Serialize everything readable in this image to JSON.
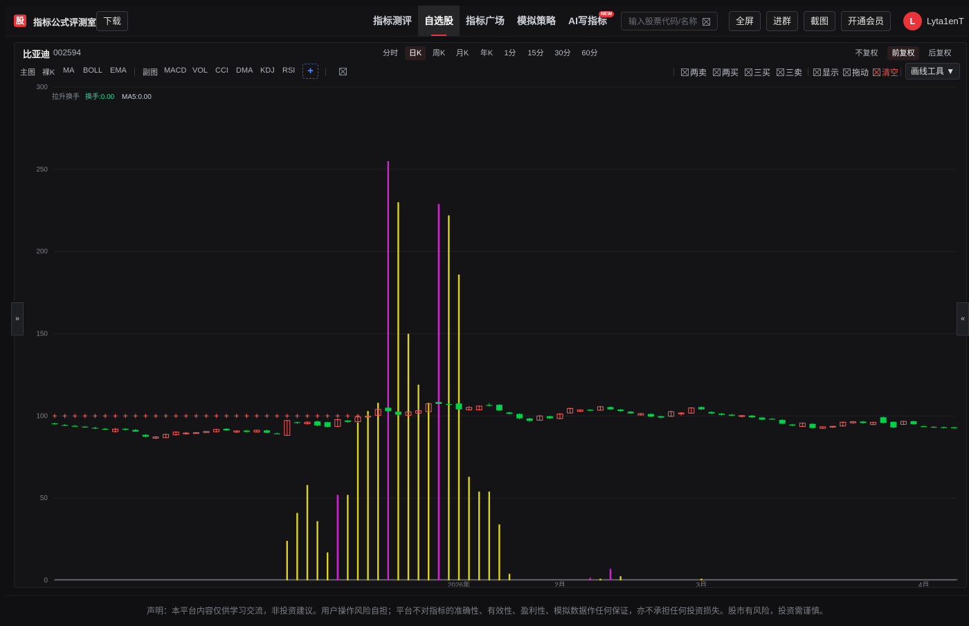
{
  "app": {
    "logo_char": "股",
    "title": "指标公式评测室",
    "download_label": "下载"
  },
  "nav": {
    "items": [
      {
        "label": "指标测评"
      },
      {
        "label": "自选股"
      },
      {
        "label": "指标广场"
      },
      {
        "label": "模拟策略"
      },
      {
        "label": "AI写指标"
      }
    ],
    "active_index": 1,
    "new_badge": "NEW"
  },
  "search": {
    "placeholder": "输入股票代码/名称",
    "value": ""
  },
  "toolbar": {
    "fullscreen": "全屏",
    "join_group": "进群",
    "screenshot": "截图",
    "membership": "开通会员"
  },
  "user": {
    "avatar_letter": "L",
    "name": "Lyta1enT"
  },
  "stock": {
    "name": "比亚迪",
    "code": "002594"
  },
  "periods": {
    "items": [
      "分时",
      "日K",
      "周K",
      "月K",
      "年K",
      "1分",
      "15分",
      "30分",
      "60分"
    ],
    "active": "日K"
  },
  "adjust": {
    "items": [
      "不复权",
      "前复权",
      "后复权"
    ],
    "active": "前复权"
  },
  "indicators": {
    "main_label": "主图",
    "main": [
      "裸K",
      "MA",
      "BOLL",
      "EMA"
    ],
    "sub_label": "副图",
    "sub": [
      "MACD",
      "VOL",
      "CCI",
      "DMA",
      "KDJ",
      "RSI"
    ],
    "plus": "+"
  },
  "options": {
    "items": [
      "两卖",
      "两买",
      "三买",
      "三卖",
      "显示",
      "拖动"
    ],
    "clear": "清空",
    "draw_tools": "画线工具 ▼"
  },
  "side": {
    "left": "»",
    "right": "«"
  },
  "legend": {
    "name": "拉升换手",
    "turnover": "换手:0.00",
    "ma5": "MA5:0.00"
  },
  "colors": {
    "up": "#ff5a5a",
    "down": "#00d04a",
    "volume_yellow": "#dcd41e",
    "volume_magenta": "#d81ed8",
    "cross": "#ff4d4d"
  },
  "footer": "声明：本平台内容仅供学习交流，非投资建议。用户操作风险自担；平台不对指标的准确性、有效性、盈利性、模拟数据作任何保证，亦不承担任何投资损失。股市有风险，投资需谨慎。",
  "chart_data": {
    "type": "bar",
    "ylim": [
      0,
      300
    ],
    "yticks": [
      0,
      50,
      100,
      150,
      200,
      250,
      300
    ],
    "xticks": [
      {
        "label": "2026年",
        "index": 40
      },
      {
        "label": "2月",
        "index": 50
      },
      {
        "label": "3月",
        "index": 64
      },
      {
        "label": "4月",
        "index": 86
      }
    ],
    "candles": [
      [
        95.5,
        96.0,
        94.5,
        95.0
      ],
      [
        94.5,
        95.0,
        93.8,
        94.2
      ],
      [
        94.0,
        94.5,
        93.4,
        93.8
      ],
      [
        93.5,
        94.0,
        92.8,
        93.2
      ],
      [
        92.8,
        93.4,
        92.0,
        92.4
      ],
      [
        92.2,
        92.8,
        91.4,
        91.8
      ],
      [
        90.5,
        92.6,
        89.8,
        92.0
      ],
      [
        92.2,
        92.6,
        91.2,
        91.6
      ],
      [
        91.5,
        92.0,
        90.2,
        90.5
      ],
      [
        88.5,
        89.0,
        87.0,
        87.4
      ],
      [
        86.5,
        87.8,
        86.0,
        87.2
      ],
      [
        86.8,
        89.2,
        86.5,
        88.8
      ],
      [
        88.5,
        90.6,
        88.2,
        90.2
      ],
      [
        89.2,
        90.3,
        88.7,
        89.6
      ],
      [
        89.6,
        90.3,
        89.2,
        89.8
      ],
      [
        89.9,
        90.9,
        89.6,
        90.6
      ],
      [
        90.4,
        92.1,
        90.1,
        91.8
      ],
      [
        92.2,
        92.6,
        90.9,
        91.2
      ],
      [
        90.2,
        91.2,
        89.6,
        90.9
      ],
      [
        91.1,
        91.5,
        89.9,
        90.3
      ],
      [
        90.3,
        91.6,
        90.0,
        91.3
      ],
      [
        91.2,
        91.6,
        89.4,
        89.8
      ],
      [
        89.4,
        89.9,
        89.0,
        89.2
      ],
      [
        88.2,
        97.6,
        87.9,
        97.2
      ],
      [
        96.2,
        96.6,
        95.2,
        95.7
      ],
      [
        95.3,
        96.7,
        94.7,
        96.2
      ],
      [
        96.7,
        97.1,
        93.7,
        94.2
      ],
      [
        96.2,
        96.5,
        93.0,
        93.4
      ],
      [
        93.6,
        98.3,
        93.4,
        97.8
      ],
      [
        97.2,
        97.6,
        96.0,
        96.4
      ],
      [
        96.5,
        100.3,
        96.1,
        99.4
      ],
      [
        99.5,
        101.1,
        99.0,
        99.8
      ],
      [
        100.4,
        104.6,
        100.1,
        104.0
      ],
      [
        105.0,
        105.4,
        102.5,
        102.9
      ],
      [
        102.6,
        103.2,
        100.1,
        100.8
      ],
      [
        100.4,
        102.9,
        100.0,
        102.5
      ],
      [
        101.7,
        104.0,
        101.2,
        103.2
      ],
      [
        102.6,
        108.0,
        102.3,
        107.4
      ],
      [
        108.5,
        108.9,
        106.9,
        107.3
      ],
      [
        107.3,
        107.7,
        106.7,
        107.1
      ],
      [
        107.6,
        108.0,
        103.6,
        104.0
      ],
      [
        103.7,
        105.9,
        103.3,
        105.2
      ],
      [
        103.7,
        106.4,
        103.3,
        106.0
      ],
      [
        106.7,
        107.9,
        105.7,
        106.2
      ],
      [
        106.8,
        107.2,
        102.9,
        103.4
      ],
      [
        102.1,
        102.6,
        100.9,
        101.3
      ],
      [
        101.2,
        101.6,
        98.0,
        98.6
      ],
      [
        98.5,
        98.9,
        96.4,
        97.0
      ],
      [
        97.4,
        100.6,
        97.1,
        100.0
      ],
      [
        99.8,
        100.2,
        98.2,
        98.6
      ],
      [
        98.4,
        101.6,
        98.1,
        101.2
      ],
      [
        101.8,
        105.0,
        101.5,
        104.6
      ],
      [
        102.8,
        104.0,
        102.4,
        103.6
      ],
      [
        103.8,
        104.2,
        102.8,
        103.2
      ],
      [
        103.5,
        106.1,
        103.2,
        105.6
      ],
      [
        105.4,
        105.8,
        103.6,
        104.0
      ],
      [
        103.9,
        104.3,
        102.6,
        103.0
      ],
      [
        102.6,
        103.0,
        101.2,
        101.6
      ],
      [
        100.6,
        101.8,
        100.2,
        101.4
      ],
      [
        101.2,
        101.6,
        99.2,
        99.6
      ],
      [
        99.8,
        100.2,
        98.6,
        99.0
      ],
      [
        99.8,
        103.2,
        99.4,
        102.6
      ],
      [
        101.4,
        102.2,
        100.3,
        101.8
      ],
      [
        101.7,
        105.3,
        101.4,
        104.9
      ],
      [
        105.4,
        105.8,
        103.6,
        104.0
      ],
      [
        102.4,
        102.8,
        101.1,
        101.5
      ],
      [
        101.4,
        101.8,
        100.3,
        100.7
      ],
      [
        100.8,
        101.2,
        99.9,
        100.2
      ],
      [
        99.8,
        100.5,
        99.0,
        100.2
      ],
      [
        100.2,
        100.6,
        98.9,
        99.2
      ],
      [
        99.0,
        99.4,
        97.4,
        97.8
      ],
      [
        98.3,
        98.7,
        97.7,
        98.1
      ],
      [
        97.6,
        98.0,
        94.9,
        95.3
      ],
      [
        94.8,
        95.2,
        93.8,
        94.2
      ],
      [
        93.6,
        96.0,
        93.2,
        95.6
      ],
      [
        95.2,
        95.6,
        92.3,
        92.7
      ],
      [
        92.5,
        93.7,
        92.2,
        93.4
      ],
      [
        93.2,
        94.0,
        92.8,
        93.7
      ],
      [
        93.9,
        96.6,
        93.5,
        96.2
      ],
      [
        95.8,
        96.9,
        95.4,
        96.5
      ],
      [
        96.6,
        97.0,
        95.3,
        95.7
      ],
      [
        94.8,
        96.5,
        94.4,
        96.1
      ],
      [
        99.2,
        99.6,
        95.4,
        95.8
      ],
      [
        96.4,
        96.8,
        92.6,
        93.0
      ],
      [
        94.9,
        97.1,
        94.5,
        96.7
      ],
      [
        96.8,
        97.2,
        94.6,
        95.0
      ],
      [
        93.8,
        94.2,
        93.3,
        93.6
      ],
      [
        93.4,
        93.8,
        92.7,
        93.1
      ],
      [
        93.2,
        93.6,
        92.5,
        92.9
      ],
      [
        93.1,
        93.5,
        92.6,
        93.0
      ]
    ],
    "cross_markers": {
      "value": 100,
      "count": 31
    },
    "bars": [
      {
        "index": 23,
        "value": 24,
        "color": "yellow"
      },
      {
        "index": 24,
        "value": 41,
        "color": "yellow"
      },
      {
        "index": 25,
        "value": 58,
        "color": "yellow"
      },
      {
        "index": 26,
        "value": 36,
        "color": "yellow"
      },
      {
        "index": 27,
        "value": 17,
        "color": "yellow"
      },
      {
        "index": 28,
        "value": 52,
        "color": "magenta"
      },
      {
        "index": 29,
        "value": 52,
        "color": "yellow"
      },
      {
        "index": 30,
        "value": 96,
        "color": "yellow"
      },
      {
        "index": 31,
        "value": 103,
        "color": "yellow"
      },
      {
        "index": 32,
        "value": 108,
        "color": "yellow"
      },
      {
        "index": 33,
        "value": 255,
        "color": "magenta"
      },
      {
        "index": 34,
        "value": 230,
        "color": "yellow"
      },
      {
        "index": 35,
        "value": 150,
        "color": "yellow"
      },
      {
        "index": 36,
        "value": 119,
        "color": "yellow"
      },
      {
        "index": 37,
        "value": 108,
        "color": "yellow"
      },
      {
        "index": 38,
        "value": 229,
        "color": "magenta"
      },
      {
        "index": 39,
        "value": 222,
        "color": "yellow"
      },
      {
        "index": 40,
        "value": 186,
        "color": "yellow"
      },
      {
        "index": 41,
        "value": 63,
        "color": "yellow"
      },
      {
        "index": 42,
        "value": 54,
        "color": "yellow"
      },
      {
        "index": 43,
        "value": 54,
        "color": "yellow"
      },
      {
        "index": 44,
        "value": 34,
        "color": "yellow"
      },
      {
        "index": 45,
        "value": 4,
        "color": "yellow"
      },
      {
        "index": 53,
        "value": 1.5,
        "color": "magenta"
      },
      {
        "index": 54,
        "value": 1,
        "color": "yellow"
      },
      {
        "index": 55,
        "value": 7,
        "color": "magenta"
      },
      {
        "index": 56,
        "value": 2.5,
        "color": "yellow"
      },
      {
        "index": 64,
        "value": 1,
        "color": "yellow"
      }
    ]
  }
}
